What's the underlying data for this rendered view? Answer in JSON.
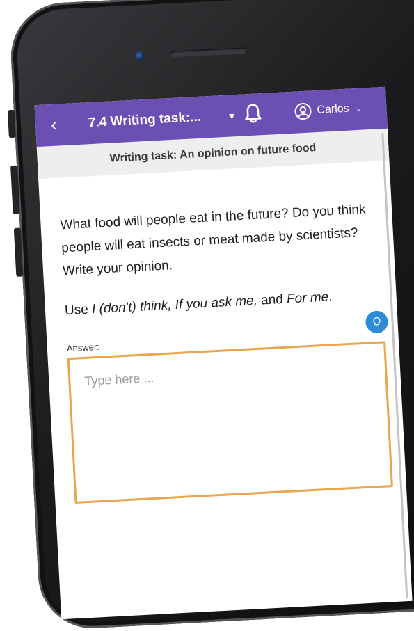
{
  "header": {
    "back_icon": "chevron-left-icon",
    "title": "7.4 Writing task:...",
    "notifications_icon": "bell-icon",
    "user_icon": "user-circle-icon",
    "user_name": "Carlos",
    "accent_color": "#6b4fb3"
  },
  "subheader": {
    "title": "Writing task: An opinion on future food"
  },
  "task": {
    "prompt": "What food will people eat in the future? Do you think people will eat insects or meat made by scientists? Write your opinion.",
    "hint_prefix": "Use ",
    "hint_italic": "I (don't) think, If you ask me,",
    "hint_middle": " and ",
    "hint_italic_2": "For me",
    "hint_suffix": ".",
    "hint_icon": "lightbulb-icon",
    "hint_icon_color": "#2d8ad6"
  },
  "answer": {
    "label": "Answer:",
    "placeholder": "Type here ...",
    "border_color": "#e9a64f"
  }
}
